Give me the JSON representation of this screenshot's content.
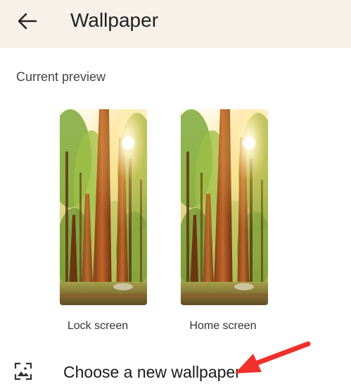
{
  "header": {
    "title": "Wallpaper",
    "back_icon": "arrow-left-icon",
    "background": "#f7f1ea"
  },
  "preview_section": {
    "label": "Current preview",
    "previews": [
      {
        "label": "Lock screen"
      },
      {
        "label": "Home screen"
      }
    ]
  },
  "choose": {
    "label": "Choose a new wallpaper",
    "icon": "image-frame-icon"
  },
  "annotation": {
    "color": "#f0302a",
    "icon": "red-arrow"
  }
}
